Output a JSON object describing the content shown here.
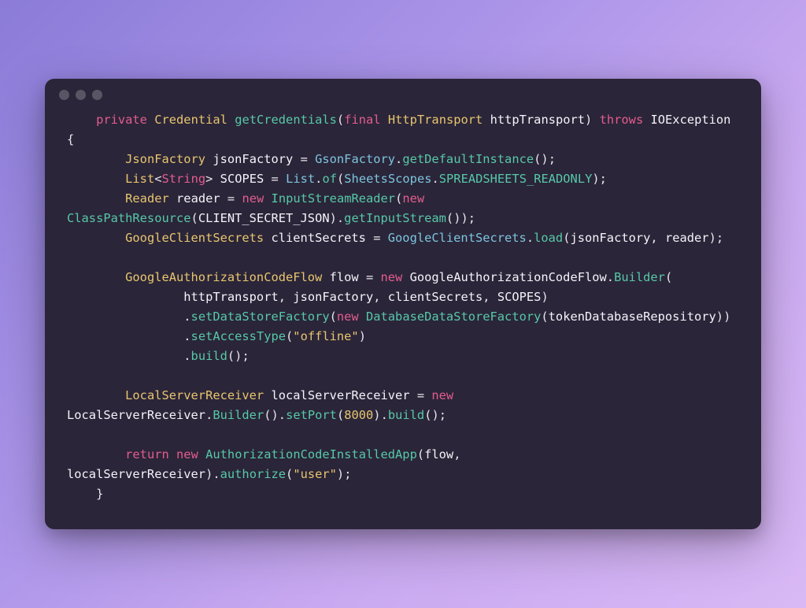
{
  "colors": {
    "window_bg": "#2b2539",
    "traffic_light": "#5a5464",
    "keyword": "#e25d8f",
    "type": "#e7c66e",
    "method": "#56c9a8",
    "text": "#e8e6ed",
    "number": "#e7c66e",
    "static": "#7cc5de"
  },
  "language": "java",
  "code": {
    "indent1": "    ",
    "indent2": "        ",
    "indent3": "                ",
    "indent4": "                ",
    "kw_private": "private",
    "kw_final": "final",
    "kw_throws": "throws",
    "kw_new": "new",
    "kw_return": "return",
    "type_Credential": "Credential",
    "type_HttpTransport": "HttpTransport",
    "type_IOException": "IOException",
    "type_JsonFactory": "JsonFactory",
    "type_GsonFactory": "GsonFactory",
    "type_List": "List",
    "type_String": "String",
    "type_SheetsScopes": "SheetsScopes",
    "type_Reader": "Reader",
    "type_InputStreamReader": "InputStreamReader",
    "type_ClassPathResource": "ClassPathResource",
    "type_GoogleClientSecrets": "GoogleClientSecrets",
    "type_GoogleAuthorizationCodeFlow": "GoogleAuthorizationCodeFlow",
    "type_DatabaseDataStoreFactory": "DatabaseDataStoreFactory",
    "type_LocalServerReceiver": "LocalServerReceiver",
    "type_AuthorizationCodeInstalledApp": "AuthorizationCodeInstalledApp",
    "mtd_getCredentials": "getCredentials",
    "mtd_getDefaultInstance": "getDefaultInstance",
    "mtd_of": "of",
    "mtd_getInputStream": "getInputStream",
    "mtd_load": "load",
    "mtd_Builder": "Builder",
    "mtd_setDataStoreFactory": "setDataStoreFactory",
    "mtd_setAccessType": "setAccessType",
    "mtd_build": "build",
    "mtd_setPort": "setPort",
    "mtd_authorize": "authorize",
    "var_httpTransport": "httpTransport",
    "var_jsonFactory": "jsonFactory",
    "var_SCOPES": "SCOPES",
    "var_reader": "reader",
    "var_clientSecrets": "clientSecrets",
    "var_flow": "flow",
    "var_localServerReceiver": "localServerReceiver",
    "var_tokenDatabaseRepository": "tokenDatabaseRepository",
    "const_SPREADSHEETS_READONLY": "SPREADSHEETS_READONLY",
    "const_CLIENT_SECRET_JSON": "CLIENT_SECRET_JSON",
    "str_offline": "\"offline\"",
    "str_user": "\"user\"",
    "num_8000": "8000",
    "p_open": "(",
    "p_close": ")",
    "brace_open": "{",
    "brace_close": "}",
    "angle_open": "<",
    "angle_close": ">",
    "semi": ";",
    "comma": ",",
    "eq": " = ",
    "dot": ".",
    "space": " ",
    "nl": "\n",
    "blank": "\n\n"
  }
}
